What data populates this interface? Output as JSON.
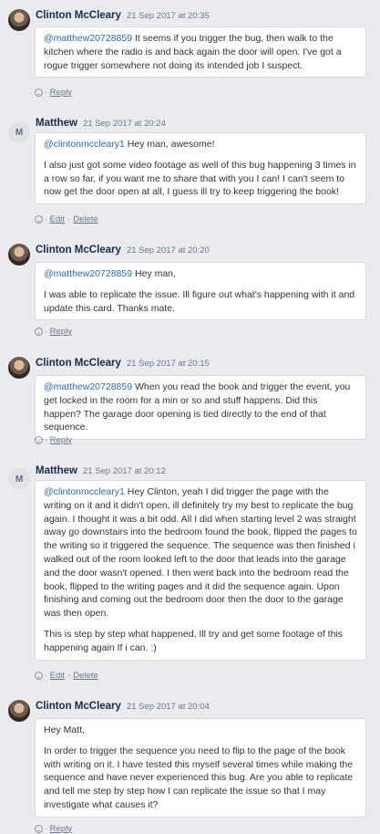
{
  "comments": [
    {
      "author": "Clinton McCleary",
      "avatar": "photo",
      "timestamp": "21 Sep 2017 at 20:35",
      "paragraphs": [
        {
          "mention": "@matthew20728859",
          "text": " It seems if you trigger the bug, then walk to the kitchen where the radio is and back again the door will open. I've got a rogue trigger somewhere not doing its intended job I suspect."
        }
      ],
      "actions": [
        "Reply"
      ]
    },
    {
      "author": "Matthew",
      "avatar": "M",
      "timestamp": "21 Sep 2017 at 20:24",
      "paragraphs": [
        {
          "mention": "@clintonmccleary1",
          "text": " Hey man, awesome!"
        },
        {
          "mention": "",
          "text": "I also just got some video footage as well of this bug happening 3 times in a row so far, if you want me to share that with you I can! I can't seem to now get the door open at all, I guess ill try to keep triggering the book!"
        }
      ],
      "actions": [
        "Edit",
        "Delete"
      ]
    },
    {
      "author": "Clinton McCleary",
      "avatar": "photo",
      "timestamp": "21 Sep 2017 at 20:20",
      "paragraphs": [
        {
          "mention": "@matthew20728859",
          "text": " Hey man,"
        },
        {
          "mention": "",
          "text": "I was able to replicate the issue. Ill figure out what's happening with it and update this card. Thanks mate."
        }
      ],
      "actions": [
        "Reply"
      ]
    },
    {
      "author": "Clinton McCleary",
      "avatar": "photo",
      "timestamp": "21 Sep 2017 at 20:15",
      "paragraphs": [
        {
          "mention": "@matthew20728859",
          "text": " When you read the book and trigger the event, you get locked in the room for a min or so and stuff happens. Did this happen? The garage door opening is tied directly to the end of that sequence."
        }
      ],
      "actions": [
        "Reply"
      ]
    },
    {
      "author": "Matthew",
      "avatar": "M",
      "timestamp": "21 Sep 2017 at 20:12",
      "paragraphs": [
        {
          "mention": "@clintonmccleary1",
          "text": " Hey Clinton, yeah I did trigger the page with the writing on it and it didn't open, ill definitely try my best to replicate the bug again. I thought it was a bit odd. All I did when starting level 2 was straight away go downstairs into the bedroom found the book, flipped the pages to the writing so it triggered the sequence. The sequence was then finished i walked out of the room looked left to the door that leads into the garage and the door wasn't opened. I then went back into the bedroom read the book, flipped to the writing pages and it did the sequence again. Upon finishing and coming out the bedroom door then the door to the garage was then open."
        },
        {
          "mention": "",
          "text": "This is step by step what happened, Ill try and get some footage of this happening again If i can. :)"
        }
      ],
      "actions": [
        "Edit",
        "Delete"
      ]
    },
    {
      "author": "Clinton McCleary",
      "avatar": "photo",
      "timestamp": "21 Sep 2017 at 20:04",
      "paragraphs": [
        {
          "mention": "",
          "text": "Hey Matt,"
        },
        {
          "mention": "",
          "text": "In order to trigger the sequence you need to flip to the page of the book with writing on it. I have tested this myself several times while making the sequence and have never experienced this bug. Are you able to replicate and tell me step by step how I can replicate the issue so that I may investigate what causes it?"
        }
      ],
      "actions": [
        "Reply"
      ]
    }
  ]
}
